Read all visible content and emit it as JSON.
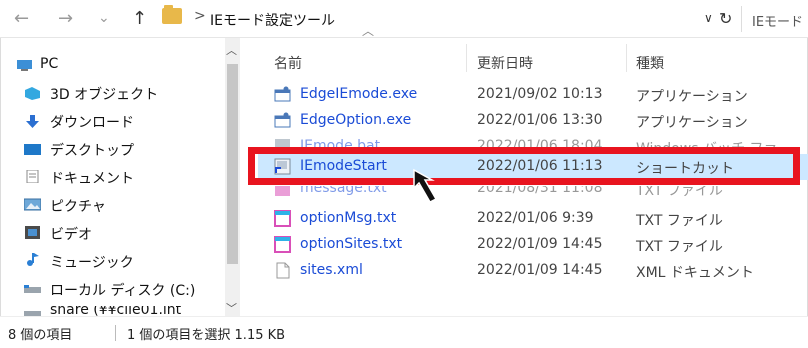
{
  "address": {
    "back_icon": "←",
    "forward_icon": "→",
    "recent_icon": "⌄",
    "up_icon": "↑",
    "separator": ">",
    "path": "IEモード設定ツール",
    "dropdown_icon": "∨",
    "refresh_icon": "↻",
    "search_placeholder": "IEモード"
  },
  "nav": {
    "items": [
      {
        "label": "PC",
        "icon": "pc-icon"
      },
      {
        "label": "3D オブジェクト",
        "icon": "3d-objects-icon"
      },
      {
        "label": "ダウンロード",
        "icon": "download-icon"
      },
      {
        "label": "デスクトップ",
        "icon": "desktop-icon"
      },
      {
        "label": "ドキュメント",
        "icon": "documents-icon"
      },
      {
        "label": "ピクチャ",
        "icon": "pictures-icon"
      },
      {
        "label": "ビデオ",
        "icon": "videos-icon"
      },
      {
        "label": "ミュージック",
        "icon": "music-icon"
      },
      {
        "label": "ローカル ディスク (C:)",
        "icon": "drive-icon"
      },
      {
        "label": "share (¥¥clie01.int",
        "icon": "network-drive-icon"
      }
    ]
  },
  "columns": {
    "name": "名前",
    "date": "更新日時",
    "type": "種類",
    "sort_icon": "︿"
  },
  "files": [
    {
      "name": "EdgeIEmode.exe",
      "date": "2021/09/02 10:13",
      "type": "アプリケーション",
      "icon": "application-icon"
    },
    {
      "name": "EdgeOption.exe",
      "date": "2022/01/06 13:30",
      "type": "アプリケーション",
      "icon": "application-icon"
    },
    {
      "name": "IEmode.bat",
      "date": "2022/01/06 18:04",
      "type": "Windows バッチ ファ",
      "icon": "batch-file-icon"
    },
    {
      "name": "IEmodeStart",
      "date": "2022/01/06 11:13",
      "type": "ショートカット",
      "icon": "shortcut-icon"
    },
    {
      "name": "message.txt",
      "date": "2021/08/31 11:08",
      "type": "TXT ファイル",
      "icon": "text-file-icon"
    },
    {
      "name": "optionMsg.txt",
      "date": "2022/01/06 9:39",
      "type": "TXT ファイル",
      "icon": "text-file-icon"
    },
    {
      "name": "optionSites.txt",
      "date": "2022/01/09 14:45",
      "type": "TXT ファイル",
      "icon": "text-file-icon"
    },
    {
      "name": "sites.xml",
      "date": "2022/01/09 14:45",
      "type": "XML ドキュメント",
      "icon": "xml-file-icon"
    }
  ],
  "status": {
    "count": "8 個の項目",
    "selection": "1 個の項目を選択  1.15 KB"
  },
  "colors": {
    "highlight": "#e8141f",
    "selection": "#cce8ff",
    "link": "#1a4bd6"
  }
}
